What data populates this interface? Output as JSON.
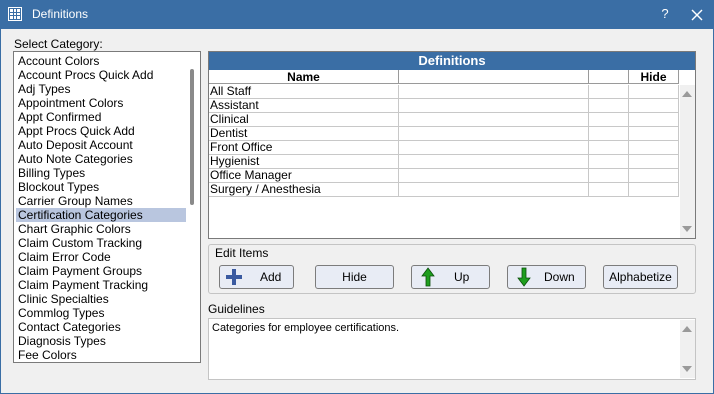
{
  "window": {
    "title": "Definitions",
    "help_label": "?"
  },
  "category": {
    "label": "Select Category:",
    "items": [
      "Account Colors",
      "Account Procs Quick Add",
      "Adj Types",
      "Appointment Colors",
      "Appt Confirmed",
      "Appt Procs Quick Add",
      "Auto Deposit Account",
      "Auto Note Categories",
      "Billing Types",
      "Blockout Types",
      "Carrier Group Names",
      "Certification Categories",
      "Chart Graphic Colors",
      "Claim Custom Tracking",
      "Claim Error Code",
      "Claim Payment Groups",
      "Claim Payment Tracking",
      "Clinic Specialties",
      "Commlog Types",
      "Contact Categories",
      "Diagnosis Types",
      "Fee Colors"
    ],
    "selected": "Certification Categories"
  },
  "definitions": {
    "title": "Definitions",
    "columns": {
      "name": "Name",
      "col2": "",
      "col3": "",
      "hide": "Hide"
    },
    "rows": [
      "All Staff",
      "Assistant",
      "Clinical",
      "Dentist",
      "Front Office",
      "Hygienist",
      "Office Manager",
      "Surgery / Anesthesia"
    ]
  },
  "edit_items": {
    "label": "Edit Items",
    "add": "Add",
    "hide": "Hide",
    "up": "Up",
    "down": "Down",
    "alphabetize": "Alphabetize"
  },
  "guidelines": {
    "label": "Guidelines",
    "text": "Categories for employee certifications."
  },
  "colors": {
    "accent": "#3a6ea5",
    "selection": "#b9c6df",
    "add_icon": "#3a5aa0",
    "up_down_icon": "#1e9e1e"
  },
  "icons": {
    "app": "grid-app-icon",
    "close": "close-icon",
    "add": "plus-icon",
    "up": "up-arrow-icon",
    "down": "down-arrow-icon"
  }
}
